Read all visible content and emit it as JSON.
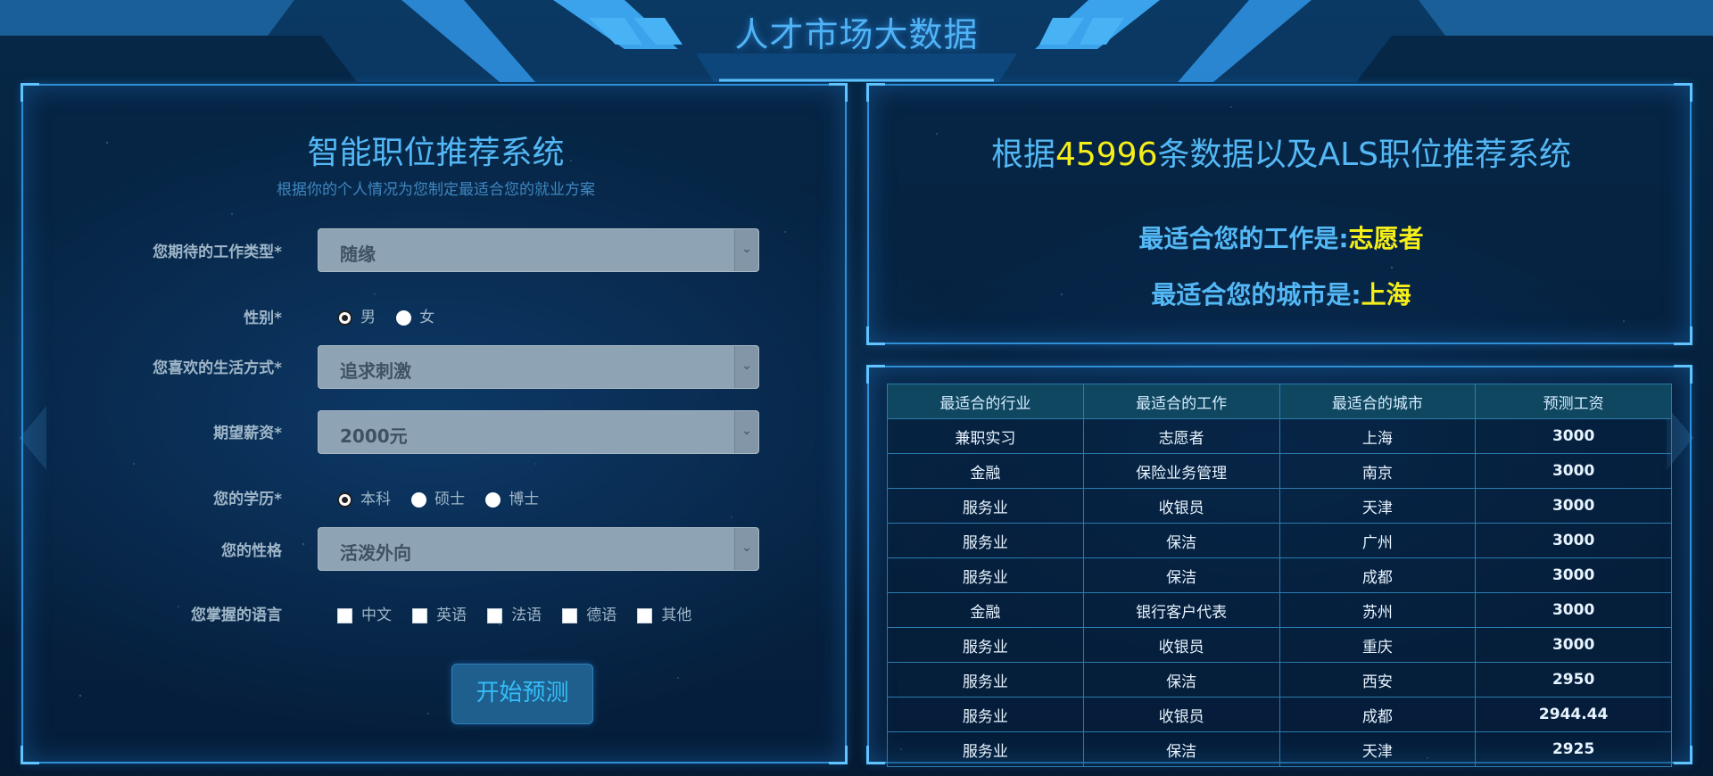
{
  "header": {
    "title": "人才市场大数据"
  },
  "form": {
    "title": "智能职位推荐系统",
    "subtitle": "根据你的个人情况为您制定最适合您的就业方案",
    "fields": {
      "job_type": {
        "label": "您期待的工作类型*",
        "value": "随缘"
      },
      "gender": {
        "label": "性别*",
        "options": [
          "男",
          "女"
        ],
        "selected": "男"
      },
      "lifestyle": {
        "label": "您喜欢的生活方式*",
        "value": "追求刺激"
      },
      "salary": {
        "label": "期望薪资*",
        "value": "2000元"
      },
      "education": {
        "label": "您的学历*",
        "options": [
          "本科",
          "硕士",
          "博士"
        ],
        "selected": "本科"
      },
      "personality": {
        "label": "您的性格",
        "value": "活泼外向"
      },
      "languages": {
        "label": "您掌握的语言",
        "options": [
          "中文",
          "英语",
          "法语",
          "德语",
          "其他"
        ]
      }
    },
    "submit_label": "开始预测"
  },
  "result": {
    "heading_prefix": "根据",
    "record_count": "45996",
    "heading_suffix": "条数据以及ALS职位推荐系统",
    "job_label": "最适合您的工作是:",
    "job_value": "志愿者",
    "city_label": "最适合您的城市是:",
    "city_value": "上海"
  },
  "table": {
    "headers": [
      "最适合的行业",
      "最适合的工作",
      "最适合的城市",
      "预测工资"
    ],
    "rows": [
      [
        "兼职实习",
        "志愿者",
        "上海",
        "3000"
      ],
      [
        "金融",
        "保险业务管理",
        "南京",
        "3000"
      ],
      [
        "服务业",
        "收银员",
        "天津",
        "3000"
      ],
      [
        "服务业",
        "保洁",
        "广州",
        "3000"
      ],
      [
        "服务业",
        "保洁",
        "成都",
        "3000"
      ],
      [
        "金融",
        "银行客户代表",
        "苏州",
        "3000"
      ],
      [
        "服务业",
        "收银员",
        "重庆",
        "3000"
      ],
      [
        "服务业",
        "保洁",
        "西安",
        "2950"
      ],
      [
        "服务业",
        "收银员",
        "成都",
        "2944.44"
      ],
      [
        "服务业",
        "保洁",
        "天津",
        "2925"
      ]
    ]
  },
  "colors": {
    "accent": "#53b8f5",
    "highlight": "#f5ee1a",
    "panel_border": "#2e8fd6"
  },
  "icons": {
    "select_arrow": "chevron-down-icon",
    "nav_prev": "arrow-left-icon",
    "nav_next": "arrow-right-icon"
  }
}
